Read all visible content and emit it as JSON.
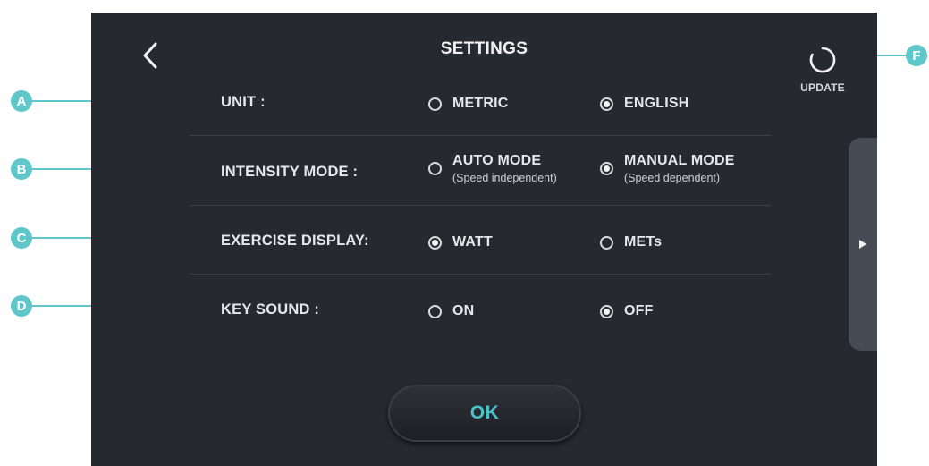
{
  "screen": {
    "title": "SETTINGS",
    "back_icon": "chevron-left-icon",
    "update": {
      "label": "UPDATE",
      "icon": "refresh-icon"
    },
    "rows": [
      {
        "label": "UNIT :",
        "options": [
          {
            "label": "METRIC",
            "sub": "",
            "selected": false
          },
          {
            "label": "ENGLISH",
            "sub": "",
            "selected": true
          }
        ]
      },
      {
        "label": "INTENSITY MODE :",
        "options": [
          {
            "label": "AUTO MODE",
            "sub": "(Speed independent)",
            "selected": false
          },
          {
            "label": "MANUAL MODE",
            "sub": "(Speed dependent)",
            "selected": true
          }
        ]
      },
      {
        "label": "EXERCISE DISPLAY:",
        "options": [
          {
            "label": "WATT",
            "sub": "",
            "selected": true
          },
          {
            "label": "METs",
            "sub": "",
            "selected": false
          }
        ]
      },
      {
        "label": "KEY SOUND :",
        "options": [
          {
            "label": "ON",
            "sub": "",
            "selected": false
          },
          {
            "label": "OFF",
            "sub": "",
            "selected": true
          }
        ]
      }
    ],
    "side_panel_icon": "play-arrow-icon",
    "ok_label": "OK"
  },
  "callouts": [
    "A",
    "B",
    "C",
    "D",
    "F"
  ],
  "colors": {
    "screen_bg": "#26292f",
    "accent": "#49c3c8",
    "callout": "#5fc6c9",
    "text": "#e6e7ea"
  }
}
